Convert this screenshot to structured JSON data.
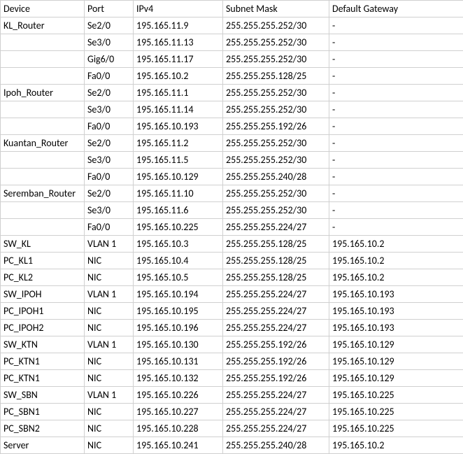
{
  "headers": {
    "device": "Device",
    "port": "Port",
    "ipv4": "IPv4",
    "mask": "Subnet Mask",
    "gateway": "Default Gateway"
  },
  "rows": [
    {
      "device": "KL_Router",
      "port": "Se2/0",
      "ipv4": "195.165.11.9",
      "mask": "255.255.255.252/30",
      "gateway": "-"
    },
    {
      "device": "",
      "port": "Se3/0",
      "ipv4": "195.165.11.13",
      "mask": "255.255.255.252/30",
      "gateway": "-"
    },
    {
      "device": "",
      "port": "Gig6/0",
      "ipv4": "195.165.11.17",
      "mask": "255.255.255.252/30",
      "gateway": "-"
    },
    {
      "device": "",
      "port": "Fa0/0",
      "ipv4": "195.165.10.2",
      "mask": "255.255.255.128/25",
      "gateway": "-"
    },
    {
      "device": "Ipoh_Router",
      "port": "Se2/0",
      "ipv4": "195.165.11.1",
      "mask": "255.255.255.252/30",
      "gateway": "-"
    },
    {
      "device": "",
      "port": "Se3/0",
      "ipv4": "195.165.11.14",
      "mask": "255.255.255.252/30",
      "gateway": "-"
    },
    {
      "device": "",
      "port": "Fa0/0",
      "ipv4": "195.165.10.193",
      "mask": "255.255.255.192/26",
      "gateway": "-"
    },
    {
      "device": "Kuantan_Router",
      "port": "Se2/0",
      "ipv4": "195.165.11.2",
      "mask": "255.255.255.252/30",
      "gateway": "-"
    },
    {
      "device": "",
      "port": "Se3/0",
      "ipv4": "195.165.11.5",
      "mask": "255.255.255.252/30",
      "gateway": "-"
    },
    {
      "device": "",
      "port": "Fa0/0",
      "ipv4": "195.165.10.129",
      "mask": "255.255.255.240/28",
      "gateway": "-"
    },
    {
      "device": "Seremban_Router",
      "port": "Se2/0",
      "ipv4": "195.165.11.10",
      "mask": "255.255.255.252/30",
      "gateway": "-"
    },
    {
      "device": "",
      "port": "Se3/0",
      "ipv4": "195.165.11.6",
      "mask": "255.255.255.252/30",
      "gateway": "-"
    },
    {
      "device": "",
      "port": "Fa0/0",
      "ipv4": "195.165.10.225",
      "mask": "255.255.255.224/27",
      "gateway": "-"
    },
    {
      "device": "SW_KL",
      "port": "VLAN 1",
      "ipv4": "195.165.10.3",
      "mask": "255.255.255.128/25",
      "gateway": "195.165.10.2"
    },
    {
      "device": "PC_KL1",
      "port": "NIC",
      "ipv4": "195.165.10.4",
      "mask": "255.255.255.128/25",
      "gateway": "195.165.10.2"
    },
    {
      "device": "PC_KL2",
      "port": "NIC",
      "ipv4": "195.165.10.5",
      "mask": "255.255.255.128/25",
      "gateway": "195.165.10.2"
    },
    {
      "device": "SW_IPOH",
      "port": "VLAN 1",
      "ipv4": "195.165.10.194",
      "mask": "255.255.255.224/27",
      "gateway": "195.165.10.193"
    },
    {
      "device": "PC_IPOH1",
      "port": "NIC",
      "ipv4": "195.165.10.195",
      "mask": "255.255.255.224/27",
      "gateway": "195.165.10.193"
    },
    {
      "device": "PC_IPOH2",
      "port": "NIC",
      "ipv4": "195.165.10.196",
      "mask": "255.255.255.224/27",
      "gateway": "195.165.10.193"
    },
    {
      "device": "SW_KTN",
      "port": "VLAN 1",
      "ipv4": "195.165.10.130",
      "mask": "255.255.255.192/26",
      "gateway": "195.165.10.129"
    },
    {
      "device": "PC_KTN1",
      "port": "NIC",
      "ipv4": "195.165.10.131",
      "mask": "255.255.255.192/26",
      "gateway": "195.165.10.129"
    },
    {
      "device": "PC_KTN1",
      "port": "NIC",
      "ipv4": "195.165.10.132",
      "mask": "255.255.255.192/26",
      "gateway": "195.165.10.129"
    },
    {
      "device": "SW_SBN",
      "port": "VLAN 1",
      "ipv4": "195.165.10.226",
      "mask": "255.255.255.224/27",
      "gateway": "195.165.10.225"
    },
    {
      "device": "PC_SBN1",
      "port": "NIC",
      "ipv4": "195.165.10.227",
      "mask": "255.255.255.224/27",
      "gateway": "195.165.10.225"
    },
    {
      "device": "PC_SBN2",
      "port": "NIC",
      "ipv4": "195.165.10.228",
      "mask": "255.255.255.224/27",
      "gateway": "195.165.10.225"
    },
    {
      "device": "Server",
      "port": "NIC",
      "ipv4": "195.165.10.241",
      "mask": "255.255.255.240/28",
      "gateway": "195.165.10.2"
    }
  ]
}
